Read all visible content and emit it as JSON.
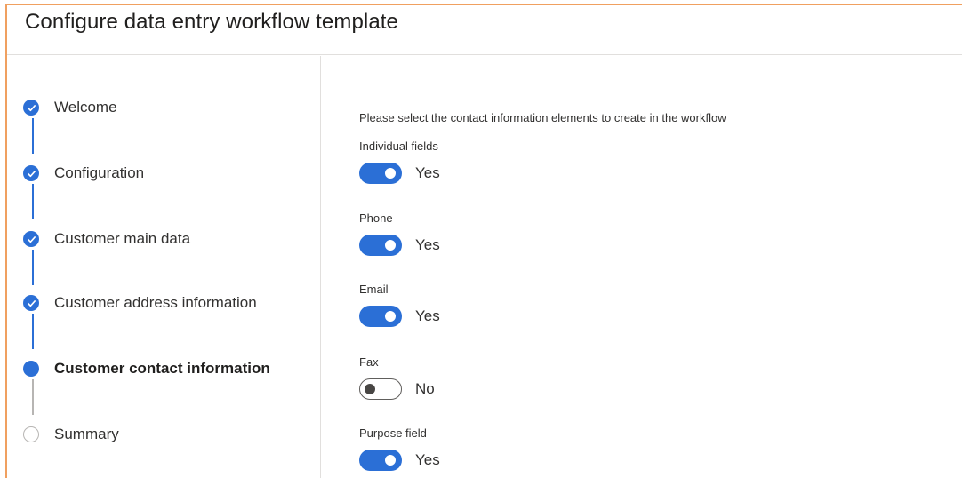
{
  "window": {
    "title": "Configure data entry workflow template"
  },
  "steps": [
    {
      "label": "Welcome",
      "state": "done"
    },
    {
      "label": "Configuration",
      "state": "done"
    },
    {
      "label": "Customer main data",
      "state": "done"
    },
    {
      "label": "Customer address information",
      "state": "done"
    },
    {
      "label": "Customer contact information",
      "state": "current"
    },
    {
      "label": "Summary",
      "state": "todo"
    }
  ],
  "main": {
    "instructions": "Please select the contact information elements to create in the workflow",
    "fields": [
      {
        "label": "Individual fields",
        "value": "Yes",
        "on": true
      },
      {
        "label": "Phone",
        "value": "Yes",
        "on": true
      },
      {
        "label": "Email",
        "value": "Yes",
        "on": true
      },
      {
        "label": "Fax",
        "value": "No",
        "on": false
      },
      {
        "label": "Purpose field",
        "value": "Yes",
        "on": true
      }
    ]
  },
  "colors": {
    "accent": "#2b6fd6",
    "frame_border": "#f0a060",
    "inactive": "#b7b5b3"
  }
}
